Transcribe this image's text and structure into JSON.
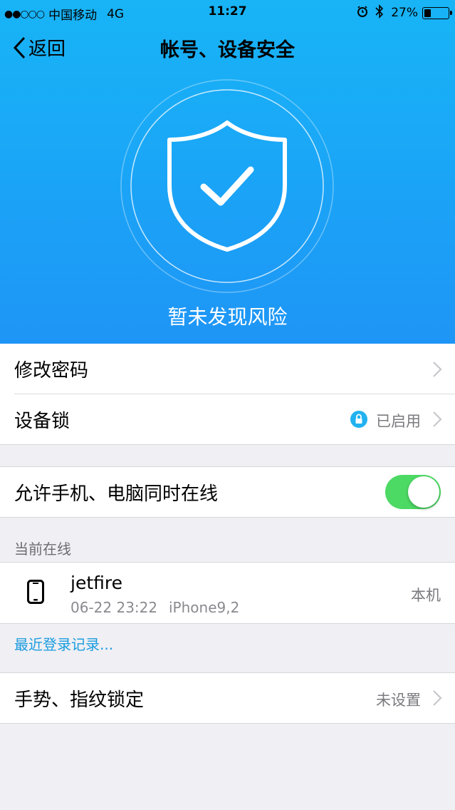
{
  "status_bar": {
    "signal": "●●○○○",
    "carrier": "中国移动",
    "network": "4G",
    "time": "11:27",
    "battery": "27%"
  },
  "nav": {
    "back_label": "返回",
    "title": "帐号、设备安全"
  },
  "hero": {
    "status_text": "暂未发现风险"
  },
  "settings": {
    "change_password": "修改密码",
    "device_lock": "设备锁",
    "device_lock_status": "已启用",
    "allow_online": "允许手机、电脑同时在线",
    "allow_online_enabled": true
  },
  "online_section": {
    "header": "当前在线",
    "device_name": "jetfire",
    "device_time": "06-22 23:22",
    "device_model": "iPhone9,2",
    "device_tag": "本机"
  },
  "recent_login_link": "最近登录记录...",
  "gesture_lock": {
    "label": "手势、指纹锁定",
    "status": "未设置"
  },
  "colors": {
    "hero_top": "#18b4f6",
    "hero_bottom": "#1e95f6",
    "toggle_on": "#4cd964",
    "link": "#1a9cdf"
  }
}
